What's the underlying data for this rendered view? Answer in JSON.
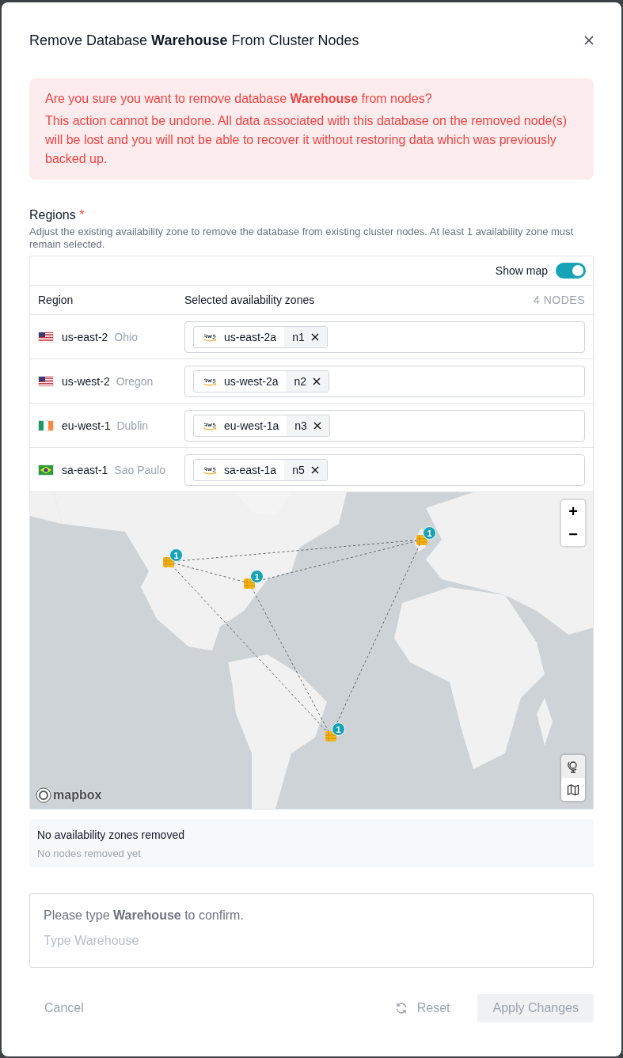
{
  "dialog": {
    "title": "Remove Database **Warehouse** From Cluster Nodes"
  },
  "alert": {
    "heading": "Are you sure you want to remove database **Warehouse** from nodes?",
    "body": "This action cannot be undone. All data associated with this database on the removed node(s) will be lost and you will not be able to recover it without restoring data which was previously backed up."
  },
  "regions_field": {
    "label": "Regions",
    "required_mark": "*",
    "hint": "Adjust the existing availability zone to remove the database from existing cluster nodes. At least 1 availability zone must remain selected."
  },
  "show_map": {
    "label": "Show map",
    "on": true
  },
  "table": {
    "columns": [
      "Region",
      "Selected availability zones"
    ],
    "count": "4 NODES",
    "rows": [
      {
        "kind": "us",
        "region": "us-east-2",
        "city": "Ohio",
        "zone": "us-east-2a",
        "node": "n1"
      },
      {
        "kind": "us",
        "region": "us-west-2",
        "city": "Oregon",
        "zone": "us-west-2a",
        "node": "n2"
      },
      {
        "kind": "ie",
        "region": "eu-west-1",
        "city": "Dublin",
        "zone": "eu-west-1a",
        "node": "n3"
      },
      {
        "kind": "br",
        "region": "sa-east-1",
        "city": "Sao Paulo",
        "zone": "sa-east-1a",
        "node": "n5"
      }
    ]
  },
  "map": {
    "zoom_in": "+",
    "zoom_out": "−",
    "attribution": "mapbox",
    "markers": [
      {
        "badge": "1"
      },
      {
        "badge": "1"
      },
      {
        "badge": "1"
      },
      {
        "badge": "1"
      }
    ]
  },
  "removed": {
    "title": "No availability zones removed",
    "subtitle": "No nodes removed yet"
  },
  "confirm": {
    "prompt": "Please type **Warehouse** to confirm.",
    "placeholder": "Type Warehouse"
  },
  "footer": [
    {
      "label": "Cancel",
      "kind": "text",
      "disabled": true
    },
    {
      "label": "Reset",
      "kind": "reset",
      "disabled": true
    },
    {
      "label": "Apply Changes",
      "kind": "primary",
      "disabled": true
    }
  ]
}
